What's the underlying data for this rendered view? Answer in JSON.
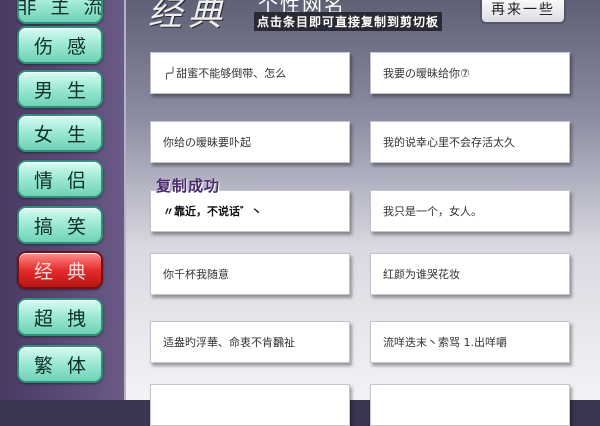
{
  "sidebar": {
    "items": [
      {
        "label": "非主流",
        "active": false
      },
      {
        "label": "伤感",
        "active": false
      },
      {
        "label": "男生",
        "active": false
      },
      {
        "label": "女生",
        "active": false
      },
      {
        "label": "情侣",
        "active": false
      },
      {
        "label": "搞笑",
        "active": false
      },
      {
        "label": "经典",
        "active": true
      },
      {
        "label": "超拽",
        "active": false
      },
      {
        "label": "繁体",
        "active": false
      }
    ]
  },
  "header": {
    "category_title": "经典",
    "subtitle": "个性网名",
    "hint": "点击条目即可直接复制到剪切板",
    "refresh_label": "再来一些"
  },
  "copied_badge": "复制成功",
  "cards": [
    [
      "╭╯甜蜜不能够倒带、怎么",
      "我要の暧昧给你⑦"
    ],
    [
      "你给の暧昧要卟起",
      "我的说幸心里不会存活太久"
    ],
    [
      "〃靠近，不说话゛丶",
      "我只是一个，女人。"
    ],
    [
      "你千杯我随意",
      "红颜为谁哭花妆"
    ],
    [
      "适盎旳浮華、命衷不肯飜祉",
      "流咩迭末丶索骂 1.出咩嚼"
    ],
    [
      "",
      ""
    ]
  ],
  "colors": {
    "active_category": "#e62c2c",
    "category_button": "#9fead4",
    "sidebar": "#5c4a78"
  }
}
